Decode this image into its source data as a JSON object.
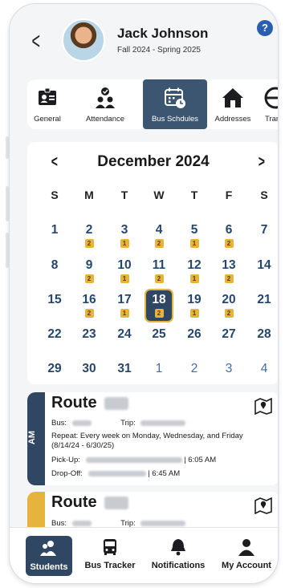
{
  "header": {
    "back_icon": "chevron-left-icon",
    "student_name": "Jack Johnson",
    "term": "Fall 2024 - Spring 2025",
    "help_label": "?"
  },
  "tabs": [
    {
      "label": "General",
      "icon": "id-card-icon"
    },
    {
      "label": "Attendance",
      "icon": "people-check-icon"
    },
    {
      "label": "Bus Schdules",
      "icon": "calendar-clock-icon",
      "active": true
    },
    {
      "label": "Addresses",
      "icon": "house-icon"
    },
    {
      "label": "Transpo",
      "icon": "transport-icon"
    }
  ],
  "calendar": {
    "month_label": "December 2024",
    "prev_label": "<",
    "next_label": ">",
    "weekdays": [
      "S",
      "M",
      "T",
      "W",
      "T",
      "F",
      "S"
    ],
    "weeks": [
      [
        {
          "d": "1"
        },
        {
          "d": "2",
          "b": "2"
        },
        {
          "d": "3",
          "b": "1"
        },
        {
          "d": "4",
          "b": "2"
        },
        {
          "d": "5",
          "b": "1"
        },
        {
          "d": "6",
          "b": "2"
        },
        {
          "d": "7"
        }
      ],
      [
        {
          "d": "8"
        },
        {
          "d": "9",
          "b": "2"
        },
        {
          "d": "10",
          "b": "1"
        },
        {
          "d": "11",
          "b": "2"
        },
        {
          "d": "12",
          "b": "1"
        },
        {
          "d": "13",
          "b": "2"
        },
        {
          "d": "14"
        }
      ],
      [
        {
          "d": "15"
        },
        {
          "d": "16",
          "b": "2"
        },
        {
          "d": "17",
          "b": "1"
        },
        {
          "d": "18",
          "b": "2",
          "selected": true
        },
        {
          "d": "19",
          "b": "1"
        },
        {
          "d": "20",
          "b": "2"
        },
        {
          "d": "21"
        }
      ],
      [
        {
          "d": "22"
        },
        {
          "d": "23"
        },
        {
          "d": "24"
        },
        {
          "d": "25"
        },
        {
          "d": "26"
        },
        {
          "d": "27"
        },
        {
          "d": "28"
        }
      ],
      [
        {
          "d": "29"
        },
        {
          "d": "30"
        },
        {
          "d": "31"
        },
        {
          "d": "1",
          "other": true
        },
        {
          "d": "2",
          "other": true
        },
        {
          "d": "3",
          "other": true
        },
        {
          "d": "4",
          "other": true
        }
      ]
    ]
  },
  "routes": [
    {
      "title": "Route",
      "band_label": "AM",
      "band_color": "#2f4763",
      "bus_label": "Bus:",
      "trip_label": "Trip:",
      "repeat": "Repeat: Every week on Monday, Wednesday, and Friday",
      "date_range": "(8/14/24 - 6/30/25)",
      "pickup_label": "Pick-Up:",
      "pickup_time": "| 6:05 AM",
      "dropoff_label": "Drop-Off:",
      "dropoff_time": "| 6:45 AM"
    },
    {
      "title": "Route",
      "band_label": "",
      "band_color": "#e6b33d",
      "bus_label": "Bus:",
      "trip_label": "Trip:"
    }
  ],
  "bottom_nav": [
    {
      "label": "Students",
      "icon": "students-icon",
      "active": true
    },
    {
      "label": "Bus Tracker",
      "icon": "bus-icon"
    },
    {
      "label": "Notifications",
      "icon": "bell-icon"
    },
    {
      "label": "My Account",
      "icon": "person-icon"
    }
  ],
  "colors": {
    "primary": "#2f4763",
    "accent": "#e6b33d",
    "date_text": "#26466b"
  }
}
